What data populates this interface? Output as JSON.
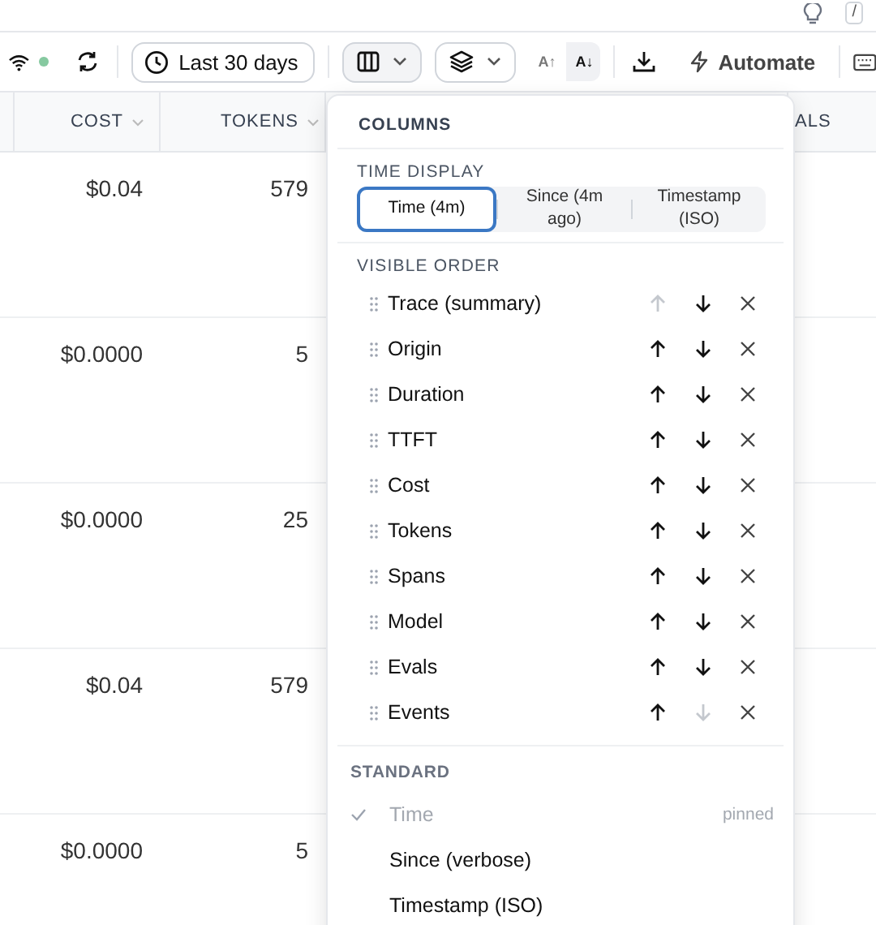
{
  "top_bar": {
    "shortcut_key": "/"
  },
  "toolbar": {
    "connection_live": true,
    "date_range": "Last 30 days",
    "sort_buttons": [
      {
        "label": "A↑",
        "selected": false
      },
      {
        "label": "A↓",
        "selected": true
      }
    ],
    "automate": "Automate"
  },
  "table": {
    "columns": [
      {
        "label": "COST"
      },
      {
        "label": "TOKENS"
      },
      {
        "label": "ALS"
      }
    ],
    "rows": [
      {
        "cost": "$0.04",
        "tokens": "579"
      },
      {
        "cost": "$0.0000",
        "tokens": "5"
      },
      {
        "cost": "$0.0000",
        "tokens": "25"
      },
      {
        "cost": "$0.04",
        "tokens": "579"
      },
      {
        "cost": "$0.0000",
        "tokens": "5"
      }
    ]
  },
  "columns_menu": {
    "title": "COLUMNS",
    "time_display": {
      "label": "TIME DISPLAY",
      "options": [
        {
          "label": "Time (4m)",
          "selected": true
        },
        {
          "label": "Since (4m ago)",
          "selected": false
        },
        {
          "label": "Timestamp (ISO)",
          "selected": false
        }
      ]
    },
    "visible_order": {
      "label": "VISIBLE ORDER",
      "items": [
        {
          "label": "Trace (summary)",
          "can_move_up": false,
          "can_move_down": true
        },
        {
          "label": "Origin",
          "can_move_up": true,
          "can_move_down": true
        },
        {
          "label": "Duration",
          "can_move_up": true,
          "can_move_down": true
        },
        {
          "label": "TTFT",
          "can_move_up": true,
          "can_move_down": true
        },
        {
          "label": "Cost",
          "can_move_up": true,
          "can_move_down": true
        },
        {
          "label": "Tokens",
          "can_move_up": true,
          "can_move_down": true
        },
        {
          "label": "Spans",
          "can_move_up": true,
          "can_move_down": true
        },
        {
          "label": "Model",
          "can_move_up": true,
          "can_move_down": true
        },
        {
          "label": "Evals",
          "can_move_up": true,
          "can_move_down": true
        },
        {
          "label": "Events",
          "can_move_up": true,
          "can_move_down": false
        }
      ]
    },
    "standard": {
      "label": "STANDARD",
      "items": [
        {
          "label": "Time",
          "checked": true,
          "note": "pinned"
        },
        {
          "label": "Since (verbose)",
          "checked": false
        },
        {
          "label": "Timestamp (ISO)",
          "checked": false
        }
      ]
    }
  }
}
